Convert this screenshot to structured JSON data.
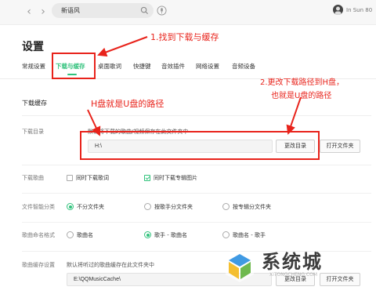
{
  "topbar": {
    "back_arrow": "‹",
    "forward_arrow": "›",
    "search_value": "新语风",
    "user_name": "In Sun 80"
  },
  "settings": {
    "title": "设置",
    "tabs": [
      {
        "label": "常规设置"
      },
      {
        "label": "下载与缓存",
        "active": true
      },
      {
        "label": "桌面歌词"
      },
      {
        "label": "快捷键"
      },
      {
        "label": "音效插件"
      },
      {
        "label": "网络设置"
      },
      {
        "label": "音频设备"
      }
    ]
  },
  "section": {
    "title": "下载缓存",
    "download_dir": {
      "label": "下载目录",
      "description": "默认将下载的歌曲/视频保存在此文件夹中",
      "path_value": "H:\\",
      "change_button": "更改目录",
      "open_button": "打开文件夹"
    },
    "download_song": {
      "label": "下载歌曲",
      "options": [
        {
          "label": "同时下载歌词",
          "checked": false
        },
        {
          "label": "同时下载专辑图片",
          "checked": true
        }
      ]
    },
    "smart_category": {
      "label": "文件智能分类",
      "options": [
        {
          "label": "不分文件夹",
          "checked": true
        },
        {
          "label": "按歌手分文件夹",
          "checked": false
        },
        {
          "label": "按专辑分文件夹",
          "checked": false
        }
      ]
    },
    "naming_format": {
      "label": "歌曲命名格式",
      "options": [
        {
          "label": "歌曲名",
          "checked": false
        },
        {
          "label": "歌手 - 歌曲名",
          "checked": true
        },
        {
          "label": "歌曲名 - 歌手",
          "checked": false
        }
      ]
    },
    "cache_settings": {
      "label": "歌曲缓存设置",
      "description": "默认将听过的歌曲缓存在此文件夹中",
      "path_value": "E:\\QQMusicCache\\",
      "change_button": "更改目录",
      "open_button": "打开文件夹"
    }
  },
  "annotations": {
    "step1": "1.找到下载与缓存",
    "step2_line1": "2.更改下载路径到H盘，",
    "step2_line2": "也就是U盘的路径",
    "note": "H盘就是U盘的路径",
    "color": "#e8231b"
  },
  "watermark": {
    "text": "系统城",
    "url": "XITONGCHENG.COM"
  },
  "colors": {
    "accent": "#31c27c",
    "annotation": "#e8231b"
  }
}
